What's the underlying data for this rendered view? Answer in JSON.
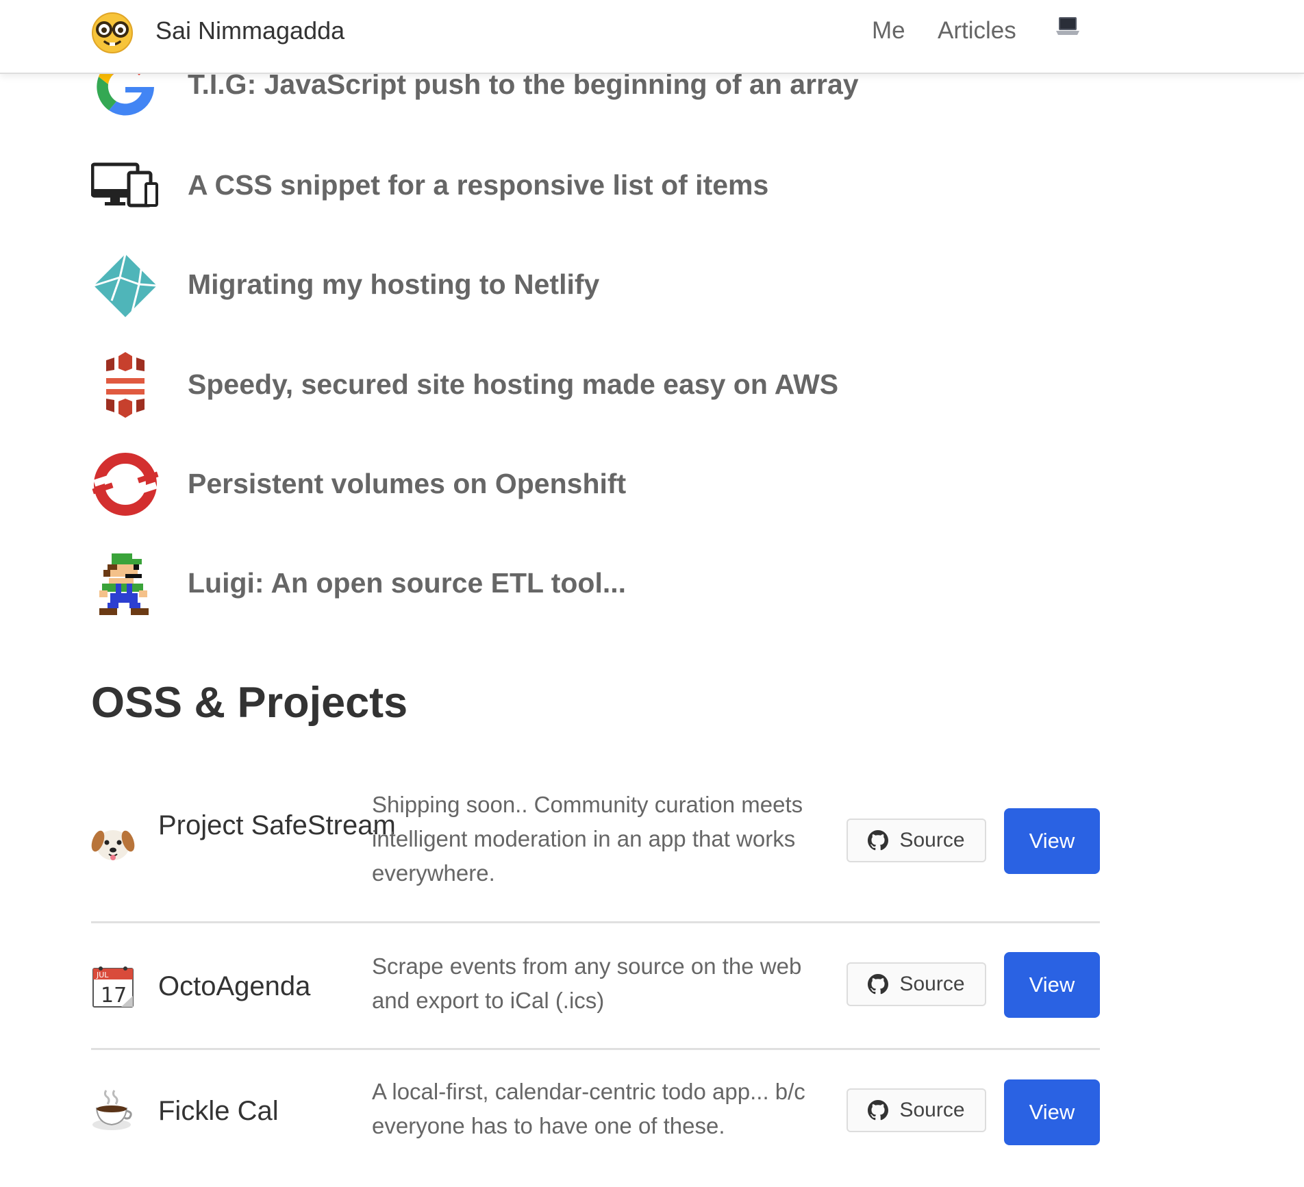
{
  "header": {
    "brand_name": "Sai Nimmagadda",
    "nav": [
      {
        "label": "Me"
      },
      {
        "label": "Articles"
      }
    ],
    "theme_toggle_icon": "laptop-icon"
  },
  "articles": [
    {
      "title": "T.I.G: JavaScript push to the beginning of an array",
      "icon": "google-logo-icon"
    },
    {
      "title": "A CSS snippet for a responsive list of items",
      "icon": "responsive-devices-icon"
    },
    {
      "title": "Migrating my hosting to Netlify",
      "icon": "netlify-logo-icon"
    },
    {
      "title": "Speedy, secured site hosting made easy on AWS",
      "icon": "aws-logo-icon"
    },
    {
      "title": "Persistent volumes on Openshift",
      "icon": "openshift-logo-icon"
    },
    {
      "title": "Luigi: An open source ETL tool...",
      "icon": "luigi-pixel-icon"
    }
  ],
  "projects_section": {
    "title": "OSS & Projects",
    "projects": [
      {
        "name": "Project SafeStream",
        "emoji": "dog-face-icon",
        "description": "Shipping soon.. Community curation meets intelligent moderation in an app that works everywhere.",
        "source_label": "Source",
        "view_label": "View"
      },
      {
        "name": "OctoAgenda",
        "emoji": "calendar-icon",
        "calendar_month": "JUL",
        "calendar_day": "17",
        "description": "Scrape events from any source on the web and export to iCal (.ics)",
        "source_label": "Source",
        "view_label": "View"
      },
      {
        "name": "Fickle Cal",
        "emoji": "hot-beverage-icon",
        "description": "A local-first, calendar-centric todo app... b/c everyone has to have one of these.",
        "source_label": "Source",
        "view_label": "View"
      }
    ]
  },
  "colors": {
    "primary_button": "#2a62e3",
    "heading_text": "#333333",
    "body_text": "#666666"
  }
}
